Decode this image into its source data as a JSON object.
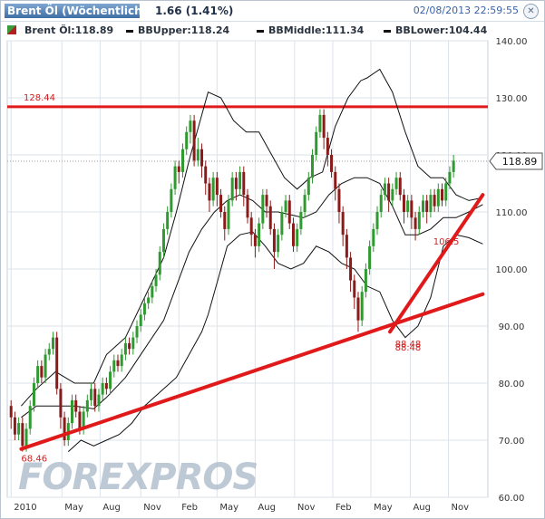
{
  "header": {
    "instrument": "Brent Öl (Wöchentlich)",
    "change": "1.66 (1.41%)",
    "timestamp": "02/08/2013 22:59:55",
    "close_symbol": "✕"
  },
  "legend": {
    "price": "Brent Öl:118.89",
    "upper": "BBUpper:118.24",
    "middle": "BBMiddle:111.34",
    "lower": "BBLower:104.44"
  },
  "watermark": "FOREXPROS",
  "chart_data": {
    "type": "candlestick",
    "title": "Brent Öl (Wöchentlich)",
    "ylim": [
      60,
      140
    ],
    "y_ticks": [
      60,
      70,
      80,
      90,
      100,
      110,
      120,
      130,
      140
    ],
    "x_tick_labels": [
      "2010",
      "May",
      "Aug",
      "Nov",
      "Feb",
      "May",
      "Aug",
      "Nov",
      "Feb",
      "May",
      "Aug",
      "Nov"
    ],
    "last_price": 118.89,
    "last_price_label": "118.89",
    "grid": true,
    "colors": {
      "up": "#2f9a2f",
      "down": "#8b1b1b",
      "trend": "#e01a1a",
      "band": "#111111",
      "grid": "#dde3ea"
    },
    "horizontal_levels": [
      {
        "value": 128.44,
        "label": "128.44"
      }
    ],
    "trend_lines": [
      {
        "from": [
          0.8,
          68.46
        ],
        "to": [
          37.1,
          95.6
        ]
      },
      {
        "from": [
          29.8,
          89.0
        ],
        "to": [
          37.1,
          113.0
        ]
      }
    ],
    "annotations": [
      {
        "x": 0.8,
        "y": 68.46,
        "label": "68.46"
      },
      {
        "x": 30.2,
        "y": 88.6,
        "label": "88.48"
      },
      {
        "x": 30.2,
        "y": 87.9,
        "label": "88.48"
      },
      {
        "x": 33.2,
        "y": 106.5,
        "label": "106.5"
      }
    ],
    "bands": {
      "upper": [
        [
          0.8,
          76
        ],
        [
          2,
          79
        ],
        [
          3.5,
          82
        ],
        [
          5,
          80
        ],
        [
          6.5,
          80
        ],
        [
          7.5,
          85
        ],
        [
          9,
          88
        ],
        [
          10.5,
          95
        ],
        [
          12,
          102
        ],
        [
          13,
          110
        ],
        [
          14,
          119
        ],
        [
          15,
          127
        ],
        [
          15.5,
          131
        ],
        [
          16.5,
          130
        ],
        [
          17.5,
          126
        ],
        [
          18.5,
          124
        ],
        [
          19.5,
          124
        ],
        [
          20.5,
          120
        ],
        [
          21.5,
          116
        ],
        [
          22.5,
          114
        ],
        [
          23.5,
          116
        ],
        [
          24.5,
          117
        ],
        [
          25.5,
          125
        ],
        [
          26.5,
          130
        ],
        [
          27.5,
          133
        ],
        [
          28,
          133.5
        ],
        [
          29,
          135
        ],
        [
          30,
          131
        ],
        [
          31,
          124
        ],
        [
          32,
          118
        ],
        [
          33,
          116
        ],
        [
          34,
          116
        ],
        [
          35,
          113
        ],
        [
          36,
          112
        ],
        [
          37.1,
          112.5
        ]
      ],
      "middle": [
        [
          0.8,
          74
        ],
        [
          2,
          76
        ],
        [
          3.5,
          76
        ],
        [
          5,
          76
        ],
        [
          6.5,
          75.5
        ],
        [
          7.5,
          77.5
        ],
        [
          9,
          81
        ],
        [
          10.5,
          86
        ],
        [
          12,
          91
        ],
        [
          13,
          97
        ],
        [
          14,
          103
        ],
        [
          15,
          107
        ],
        [
          16,
          110
        ],
        [
          17,
          112
        ],
        [
          18,
          113
        ],
        [
          19,
          112
        ],
        [
          20,
          110
        ],
        [
          21,
          110
        ],
        [
          22,
          109.5
        ],
        [
          23,
          109
        ],
        [
          24,
          110
        ],
        [
          25,
          113
        ],
        [
          26,
          115
        ],
        [
          27,
          116
        ],
        [
          28,
          116
        ],
        [
          29,
          115
        ],
        [
          30,
          111
        ],
        [
          31,
          106
        ],
        [
          32,
          106
        ],
        [
          33,
          107
        ],
        [
          34,
          109
        ],
        [
          35,
          109
        ],
        [
          36,
          110
        ],
        [
          37.1,
          111.3
        ]
      ],
      "lower": [
        [
          4.5,
          68
        ],
        [
          5.5,
          70
        ],
        [
          6.5,
          69
        ],
        [
          7.5,
          70
        ],
        [
          8.5,
          71
        ],
        [
          9.5,
          73
        ],
        [
          10.5,
          76
        ],
        [
          12,
          79
        ],
        [
          13,
          81
        ],
        [
          14,
          85
        ],
        [
          15,
          89
        ],
        [
          15.5,
          92
        ],
        [
          16.5,
          100
        ],
        [
          17,
          104
        ],
        [
          18,
          106
        ],
        [
          19,
          106.5
        ],
        [
          20,
          104
        ],
        [
          21,
          101
        ],
        [
          22,
          100
        ],
        [
          23,
          101
        ],
        [
          24,
          104
        ],
        [
          25,
          103
        ],
        [
          26,
          101
        ],
        [
          27,
          100
        ],
        [
          28,
          97
        ],
        [
          29,
          96
        ],
        [
          30,
          91
        ],
        [
          31,
          88
        ],
        [
          32,
          90
        ],
        [
          33,
          95
        ],
        [
          34,
          104
        ],
        [
          35,
          106
        ],
        [
          36,
          105.5
        ],
        [
          37.1,
          104.4
        ]
      ]
    },
    "candles": [
      [
        0.0,
        76,
        74,
        77,
        72
      ],
      [
        0.3,
        74,
        71,
        75,
        70
      ],
      [
        0.6,
        71,
        73,
        74,
        70
      ],
      [
        0.9,
        73,
        69,
        74,
        68
      ],
      [
        1.2,
        69,
        72,
        73,
        68
      ],
      [
        1.5,
        72,
        76,
        77,
        71
      ],
      [
        1.8,
        76,
        80,
        81,
        75
      ],
      [
        2.1,
        80,
        83,
        84,
        79
      ],
      [
        2.4,
        83,
        81,
        84,
        80
      ],
      [
        2.7,
        81,
        85,
        86,
        80
      ],
      [
        3.0,
        85,
        86,
        87,
        84
      ],
      [
        3.3,
        86,
        88,
        89,
        85
      ],
      [
        3.6,
        88,
        79,
        89,
        78
      ],
      [
        3.9,
        79,
        74,
        80,
        72
      ],
      [
        4.2,
        74,
        70,
        75,
        69
      ],
      [
        4.5,
        70,
        73,
        74,
        69
      ],
      [
        4.8,
        73,
        77,
        78,
        72
      ],
      [
        5.1,
        77,
        75,
        78,
        74
      ],
      [
        5.4,
        75,
        72,
        76,
        71
      ],
      [
        5.7,
        72,
        75,
        76,
        71
      ],
      [
        6.0,
        75,
        77,
        78,
        74
      ],
      [
        6.3,
        77,
        79,
        80,
        76
      ],
      [
        6.6,
        79,
        76,
        80,
        75
      ],
      [
        6.9,
        76,
        78,
        79,
        75
      ],
      [
        7.2,
        78,
        80,
        81,
        77
      ],
      [
        7.5,
        80,
        79,
        81,
        78
      ],
      [
        7.8,
        79,
        82,
        83,
        78
      ],
      [
        8.1,
        82,
        84,
        85,
        81
      ],
      [
        8.4,
        84,
        83,
        85,
        82
      ],
      [
        8.7,
        83,
        85,
        86,
        82
      ],
      [
        9.0,
        85,
        87,
        88,
        84
      ],
      [
        9.3,
        87,
        86,
        88,
        85
      ],
      [
        9.6,
        86,
        88,
        89,
        85
      ],
      [
        9.9,
        88,
        90,
        91,
        87
      ],
      [
        10.2,
        90,
        92,
        93,
        89
      ],
      [
        10.5,
        92,
        94,
        95,
        91
      ],
      [
        10.8,
        94,
        95,
        96,
        93
      ],
      [
        11.1,
        95,
        97,
        98,
        94
      ],
      [
        11.4,
        97,
        99,
        100,
        96
      ],
      [
        11.7,
        99,
        103,
        104,
        98
      ],
      [
        12.0,
        103,
        107,
        108,
        102
      ],
      [
        12.3,
        107,
        110,
        111,
        106
      ],
      [
        12.6,
        110,
        114,
        115,
        109
      ],
      [
        12.9,
        114,
        118,
        119,
        113
      ],
      [
        13.2,
        118,
        117,
        119,
        115
      ],
      [
        13.5,
        117,
        121,
        122,
        116
      ],
      [
        13.8,
        121,
        124,
        125,
        120
      ],
      [
        14.1,
        124,
        126,
        127,
        122
      ],
      [
        14.4,
        126,
        119,
        127,
        118
      ],
      [
        14.7,
        119,
        121,
        123,
        118
      ],
      [
        15.0,
        121,
        118,
        122,
        116
      ],
      [
        15.3,
        118,
        115,
        119,
        113
      ],
      [
        15.6,
        115,
        112,
        116,
        110
      ],
      [
        15.9,
        112,
        116,
        117,
        111
      ],
      [
        16.2,
        116,
        113,
        117,
        111
      ],
      [
        16.5,
        113,
        110,
        114,
        109
      ],
      [
        16.8,
        110,
        107,
        111,
        105
      ],
      [
        17.1,
        107,
        112,
        113,
        106
      ],
      [
        17.4,
        112,
        116,
        117,
        111
      ],
      [
        17.7,
        116,
        114,
        117,
        112
      ],
      [
        18.0,
        114,
        117,
        118,
        113
      ],
      [
        18.3,
        117,
        113,
        118,
        111
      ],
      [
        18.6,
        113,
        109,
        114,
        108
      ],
      [
        18.9,
        109,
        106,
        110,
        104
      ],
      [
        19.2,
        106,
        104,
        107,
        102
      ],
      [
        19.5,
        104,
        108,
        109,
        103
      ],
      [
        19.8,
        108,
        113,
        114,
        107
      ],
      [
        20.1,
        113,
        111,
        114,
        109
      ],
      [
        20.4,
        111,
        107,
        112,
        106
      ],
      [
        20.7,
        107,
        103,
        108,
        100
      ],
      [
        21.0,
        103,
        106,
        107,
        102
      ],
      [
        21.3,
        106,
        110,
        111,
        105
      ],
      [
        21.6,
        110,
        112,
        113,
        109
      ],
      [
        21.9,
        112,
        108,
        113,
        107
      ],
      [
        22.2,
        108,
        104,
        109,
        103
      ],
      [
        22.5,
        104,
        107,
        108,
        103
      ],
      [
        22.8,
        107,
        110,
        111,
        106
      ],
      [
        23.1,
        110,
        113,
        114,
        109
      ],
      [
        23.4,
        113,
        116,
        117,
        112
      ],
      [
        23.7,
        116,
        120,
        121,
        115
      ],
      [
        24.0,
        120,
        124,
        125,
        119
      ],
      [
        24.3,
        124,
        127,
        128,
        123
      ],
      [
        24.6,
        127,
        123,
        128,
        121
      ],
      [
        24.9,
        123,
        120,
        124,
        118
      ],
      [
        25.2,
        120,
        117,
        121,
        116
      ],
      [
        25.5,
        117,
        114,
        118,
        112
      ],
      [
        25.8,
        114,
        110,
        115,
        108
      ],
      [
        26.1,
        110,
        106,
        111,
        104
      ],
      [
        26.4,
        106,
        102,
        107,
        100
      ],
      [
        26.7,
        102,
        98,
        103,
        96
      ],
      [
        27.0,
        98,
        95,
        99,
        93
      ],
      [
        27.3,
        95,
        91,
        96,
        89
      ],
      [
        27.6,
        91,
        96,
        97,
        90
      ],
      [
        27.9,
        96,
        100,
        101,
        95
      ],
      [
        28.2,
        100,
        104,
        105,
        99
      ],
      [
        28.5,
        104,
        107,
        108,
        103
      ],
      [
        28.8,
        107,
        110,
        111,
        106
      ],
      [
        29.1,
        110,
        113,
        114,
        109
      ],
      [
        29.4,
        113,
        115,
        116,
        112
      ],
      [
        29.7,
        115,
        112,
        116,
        110
      ],
      [
        30.0,
        112,
        114,
        115,
        111
      ],
      [
        30.3,
        114,
        116,
        117,
        113
      ],
      [
        30.6,
        116,
        113,
        117,
        112
      ],
      [
        30.9,
        113,
        110,
        114,
        108
      ],
      [
        31.2,
        110,
        112,
        113,
        109
      ],
      [
        31.5,
        112,
        109,
        113,
        107
      ],
      [
        31.8,
        109,
        107,
        110,
        105
      ],
      [
        32.1,
        107,
        110,
        111,
        106
      ],
      [
        32.4,
        110,
        112,
        113,
        109
      ],
      [
        32.7,
        112,
        110,
        113,
        108
      ],
      [
        33.0,
        110,
        113,
        114,
        109
      ],
      [
        33.3,
        113,
        111,
        114,
        110
      ],
      [
        33.6,
        111,
        114,
        115,
        110
      ],
      [
        33.9,
        114,
        112,
        115,
        111
      ],
      [
        34.2,
        112,
        115,
        116,
        111
      ],
      [
        34.5,
        115,
        117,
        118,
        114
      ],
      [
        34.8,
        117,
        119,
        120,
        116
      ]
    ]
  }
}
